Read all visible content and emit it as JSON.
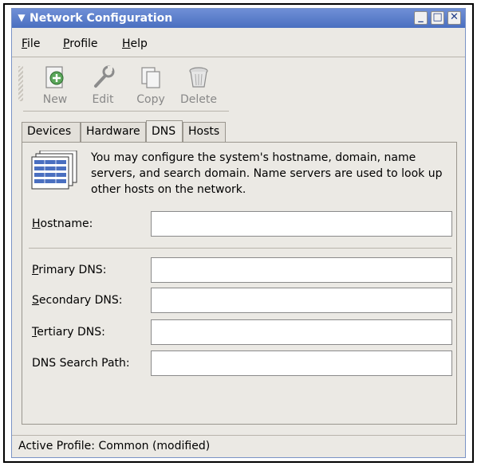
{
  "window": {
    "title": "Network Configuration"
  },
  "menu": {
    "file": "File",
    "profile": "Profile",
    "help": "Help"
  },
  "toolbar": {
    "new": "New",
    "edit": "Edit",
    "copy": "Copy",
    "delete": "Delete"
  },
  "tabs": {
    "devices": "Devices",
    "hardware": "Hardware",
    "dns": "DNS",
    "hosts": "Hosts"
  },
  "dns": {
    "description": "You may configure the system's hostname, domain, name servers, and search domain. Name servers are used to look up other hosts on the network.",
    "hostname_label": "Hostname:",
    "hostname_value": "",
    "primary_label": "Primary DNS:",
    "primary_value": "",
    "secondary_label": "Secondary DNS:",
    "secondary_value": "",
    "tertiary_label": "Tertiary DNS:",
    "tertiary_value": "",
    "search_label": "DNS Search Path:",
    "search_value": ""
  },
  "status": {
    "text": "Active Profile: Common (modified)"
  }
}
